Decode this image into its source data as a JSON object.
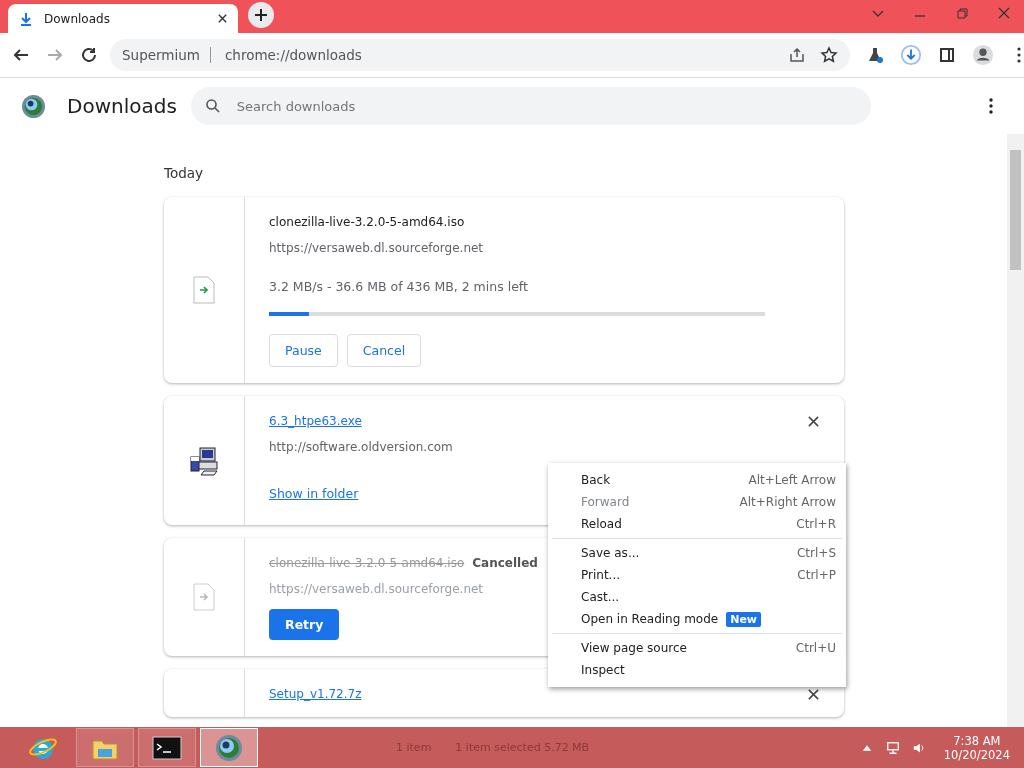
{
  "tab": {
    "title": "Downloads"
  },
  "address_bar": {
    "site": "Supermium",
    "url": "chrome://downloads"
  },
  "page": {
    "title": "Downloads",
    "search": {
      "placeholder": "Search downloads"
    }
  },
  "section": "Today",
  "downloads": [
    {
      "kind": "in_progress",
      "name": "clonezilla-live-3.2.0-5-amd64.iso",
      "source": "https://versaweb.dl.sourceforge.net",
      "status": "3.2 MB/s - 36.6 MB of 436 MB, 2 mins left",
      "level": 0.08,
      "buttons": [
        "Pause",
        "Cancel"
      ]
    },
    {
      "kind": "complete",
      "name": "6.3_htpe63.exe",
      "source": "http://software.oldversion.com",
      "link": "Show in folder"
    },
    {
      "kind": "cancelled",
      "name": "clonezilla-live-3.2.0-5-amd64.iso",
      "status": "Cancelled",
      "source": "https://versaweb.dl.sourceforge.net",
      "buttons": [
        "Retry"
      ]
    },
    {
      "kind": "complete",
      "name": "Setup_v1.72.7z"
    }
  ],
  "context_menu": [
    [
      {
        "label": "Back",
        "shortcut": "Alt+Left Arrow",
        "disabled": false
      },
      {
        "label": "Forward",
        "shortcut": "Alt+Right Arrow",
        "disabled": true
      },
      {
        "label": "Reload",
        "shortcut": "Ctrl+R",
        "disabled": false
      }
    ],
    [
      {
        "label": "Save as...",
        "shortcut": "Ctrl+S",
        "disabled": false
      },
      {
        "label": "Print...",
        "shortcut": "Ctrl+P",
        "disabled": false
      },
      {
        "label": "Cast...",
        "disabled": false
      },
      {
        "label": "Open in Reading mode",
        "badge": "New",
        "disabled": false
      }
    ],
    [
      {
        "label": "View page source",
        "shortcut": "Ctrl+U",
        "disabled": false
      },
      {
        "label": "Inspect",
        "disabled": false
      }
    ]
  ],
  "taskbar": {
    "apps": [
      {
        "kind": "ie",
        "selected": false
      },
      {
        "kind": "folder",
        "selected": false
      },
      {
        "kind": "cmd",
        "selected": false
      },
      {
        "kind": "globe",
        "selected": true
      }
    ],
    "status": [
      "1 item",
      "1 item selected  5.72 MB"
    ],
    "time": "7:38 AM",
    "date": "10/20/2024"
  }
}
